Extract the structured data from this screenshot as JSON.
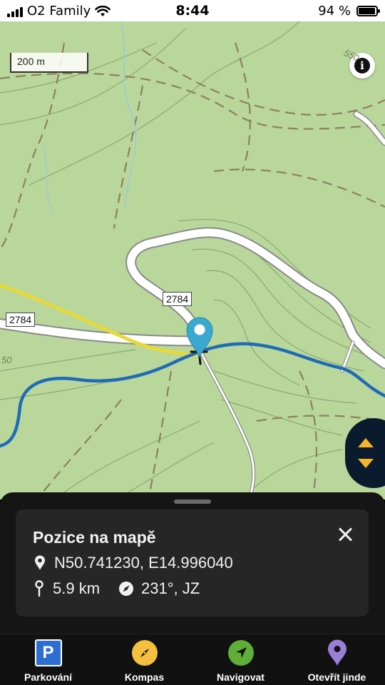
{
  "status_bar": {
    "carrier": "O2 Family",
    "time": "8:44",
    "battery": "94 %",
    "battery_level": 0.94
  },
  "map": {
    "scale_label": "200 m",
    "road_labels": [
      "2784",
      "2784"
    ],
    "contour_labels": [
      "550",
      "50"
    ],
    "colors": {
      "terrain": "#b9d79b",
      "contour": "#8aa872",
      "route": "#1f6bb7",
      "trail": "#e8d93a",
      "road": "#ffffff",
      "marker": "#3aa9cf",
      "stream": "#9cc9d6"
    },
    "icons": {
      "info": "info-icon",
      "marker": "location-pin-icon",
      "pan_up": "arrow-up-icon",
      "pan_down": "arrow-down-icon"
    }
  },
  "sheet": {
    "title": "Pozice na mapě",
    "coordinates": "N50.741230, E14.996040",
    "distance": "5.9 km",
    "bearing": "231°, JZ"
  },
  "tabs": [
    {
      "label": "Parkování",
      "icon": "parking-icon",
      "color": "#2c6fd1"
    },
    {
      "label": "Kompas",
      "icon": "compass-icon",
      "color": "#f5c03d"
    },
    {
      "label": "Navigovat",
      "icon": "navigate-arrow-icon",
      "color": "#5fae37"
    },
    {
      "label": "Otevřít jinde",
      "icon": "pin-icon",
      "color": "#9a7fd6"
    }
  ]
}
